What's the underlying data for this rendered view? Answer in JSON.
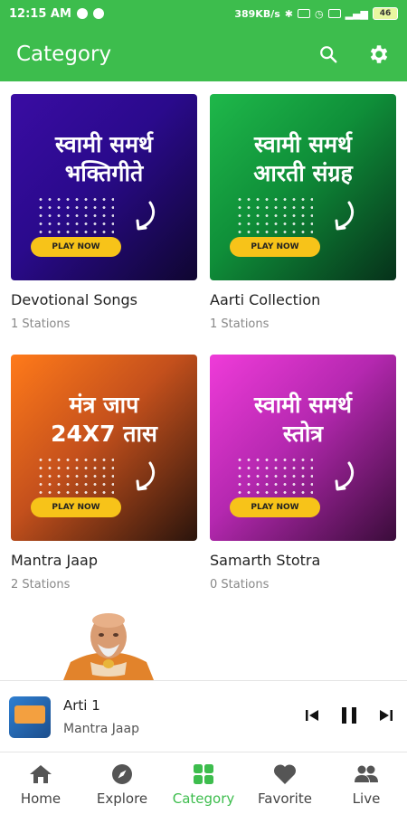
{
  "status_bar": {
    "time": "12:15 AM",
    "speed": "389KB/s",
    "battery": "46"
  },
  "app_bar": {
    "title": "Category",
    "search_icon": "search-icon",
    "settings_icon": "gear-icon"
  },
  "categories": [
    {
      "art_text_line1": "स्वामी समर्थ",
      "art_text_line2": "भक्तिगीते",
      "play_label": "PLAY NOW",
      "name": "Devotional Songs",
      "count": "1 Stations",
      "color": "#3a0ca3"
    },
    {
      "art_text_line1": "स्वामी समर्थ",
      "art_text_line2": "आरती संग्रह",
      "play_label": "PLAY NOW",
      "name": "Aarti Collection",
      "count": "1 Stations",
      "color": "#1fb84a"
    },
    {
      "art_text_line1": "मंत्र जाप",
      "art_text_line2": "24X7 तास",
      "play_label": "PLAY NOW",
      "name": "Mantra Jaap",
      "count": "2 Stations",
      "color": "#ff7a1a"
    },
    {
      "art_text_line1": "स्वामी समर्थ",
      "art_text_line2": "स्तोत्र",
      "play_label": "PLAY NOW",
      "name": "Samarth Stotra",
      "count": "0 Stations",
      "color": "#ef3bd9"
    }
  ],
  "mini_player": {
    "title": "Arti 1",
    "subtitle": "Mantra Jaap",
    "prev_icon": "skip-previous-icon",
    "pause_icon": "pause-icon",
    "next_icon": "skip-next-icon"
  },
  "bottom_nav": {
    "active_color": "#3dbd4d",
    "items": [
      {
        "label": "Home",
        "icon": "home-icon"
      },
      {
        "label": "Explore",
        "icon": "compass-icon"
      },
      {
        "label": "Category",
        "icon": "grid-icon"
      },
      {
        "label": "Favorite",
        "icon": "heart-icon"
      },
      {
        "label": "Live",
        "icon": "people-icon"
      }
    ]
  }
}
